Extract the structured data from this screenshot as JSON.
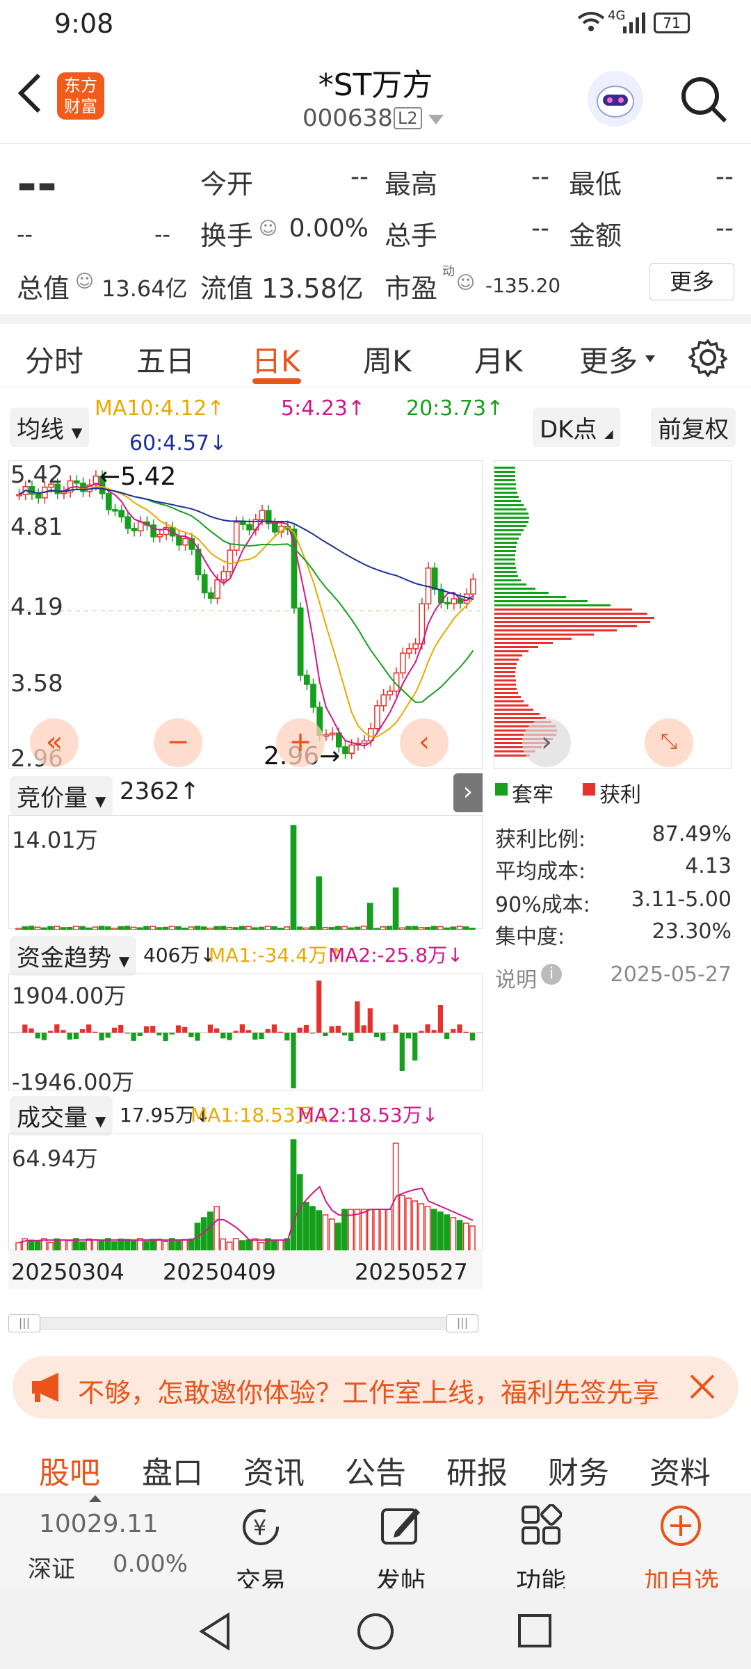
{
  "status": {
    "time": "9:08",
    "network": "4G",
    "battery": "71"
  },
  "header": {
    "brand_logo_text": "东方财富",
    "title": "*ST万方",
    "code": "000638",
    "level": "L2"
  },
  "quote": {
    "price": "--",
    "change": "--",
    "change_pct": "--",
    "open_label": "今开",
    "open": "--",
    "high_label": "最高",
    "high": "--",
    "low_label": "最低",
    "low": "--",
    "turnover_label": "换手",
    "turnover": "0.00%",
    "total_hand_label": "总手",
    "total_hand": "--",
    "amount_label": "金额",
    "amount": "--",
    "mktcap_label": "总值",
    "mktcap": "13.64亿",
    "float_label": "流值",
    "float": "13.58亿",
    "pe_label": "市盈",
    "pe_sup": "动",
    "pe": "-135.20",
    "more_button": "更多"
  },
  "tabs": [
    "分时",
    "五日",
    "日K",
    "周K",
    "月K",
    "更多"
  ],
  "kline": {
    "indicator_select": "均线",
    "ma10": "MA10:4.12↑",
    "ma5": "5:4.23↑",
    "ma20": "20:3.73↑",
    "ma60": "60:4.57↓",
    "dk_button": "DK点",
    "adjust_button": "前复权",
    "y_labels": [
      "5.42",
      "4.81",
      "4.19",
      "3.58",
      "2.96"
    ],
    "max_marker": "←5.42",
    "min_marker": "2.96→",
    "colors": {
      "up": "#e8302c",
      "down": "#15a01c",
      "ma5": "#d0168a",
      "ma10": "#e8a900",
      "ma20": "#15a01c",
      "ma60": "#1b2f9a"
    }
  },
  "auction": {
    "select": "竞价量",
    "value": "2362↑",
    "max_label": "14.01万"
  },
  "fund": {
    "select": "资金趋势",
    "value": "406万↓",
    "ma1": "MA1:-34.4万↑",
    "ma2": "MA2:-25.8万↓",
    "top": "1904.00万",
    "bottom": "-1946.00万"
  },
  "volume": {
    "select": "成交量",
    "value": "17.95万↓",
    "ma1": "MA1:18.53万↓",
    "ma2": "MA2:18.53万↓",
    "max_label": "64.94万"
  },
  "dates": [
    "20250304",
    "20250409",
    "20250527"
  ],
  "chip": {
    "legend_trapped": "套牢",
    "legend_profit": "获利",
    "profit_ratio_label": "获利比例:",
    "profit_ratio": "87.49%",
    "avg_cost_label": "平均成本:",
    "avg_cost": "4.13",
    "cost90_label": "90%成本:",
    "cost90": "3.11-5.00",
    "concentration_label": "集中度:",
    "concentration": "23.30%",
    "note_label": "说明",
    "date": "2025-05-27"
  },
  "banner": {
    "text": "不够，怎敢邀你体验？工作室上线，福利先签先享"
  },
  "bottom_tabs": [
    "股吧",
    "盘口",
    "资讯",
    "公告",
    "研报",
    "财务",
    "资料"
  ],
  "toolbar": {
    "index_value": "10029.11",
    "index_name": "深证",
    "index_pct": "0.00%",
    "trade": "交易",
    "post": "发帖",
    "function": "功能",
    "add_watch": "加自选"
  }
}
